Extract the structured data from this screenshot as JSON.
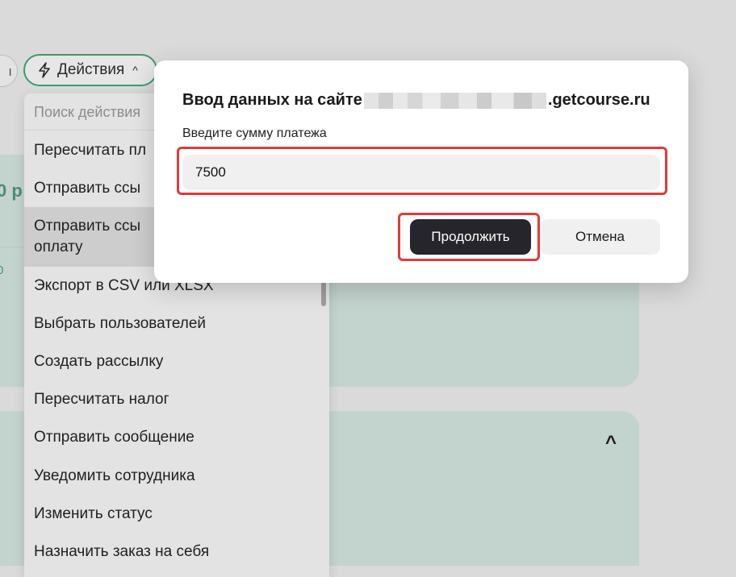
{
  "background": {
    "left_pill_text": "ı",
    "actions_button": {
      "label": "Действия",
      "icon": "lightning-icon"
    },
    "card1_amount_fragment": "0 р",
    "card1_small_fragment": "0"
  },
  "menu": {
    "search_placeholder": "Поиск действия",
    "items": [
      "Пересчитать пл",
      "Отправить ссы",
      "Отправить ссы",
      "оплату",
      "Экспорт в CSV или XLSX",
      "Выбрать пользователей",
      "Создать рассылку",
      "Пересчитать налог",
      "Отправить сообщение",
      "Уведомить сотрудника",
      "Изменить статус",
      "Назначить заказ на себя"
    ]
  },
  "modal": {
    "title_prefix": "Ввод данных на сайте",
    "title_suffix": ".getcourse.ru",
    "field_label": "Введите сумму платежа",
    "field_value": "7500",
    "continue_label": "Продолжить",
    "cancel_label": "Отмена"
  },
  "colors": {
    "accent_green": "#3d9a6e",
    "highlight_red": "#e03b3b",
    "primary_button": "#25252b"
  }
}
